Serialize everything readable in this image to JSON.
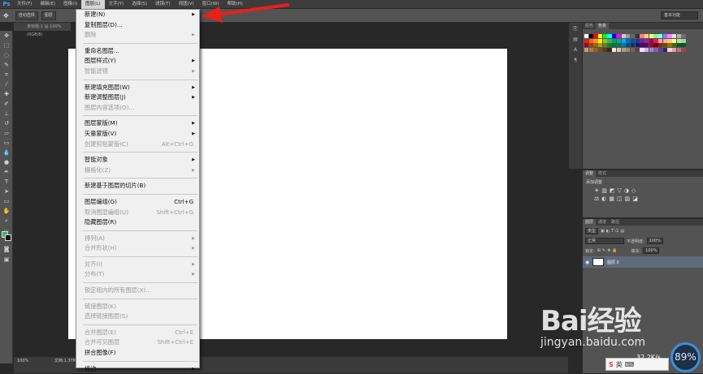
{
  "menubar": {
    "logo": "Ps",
    "items": [
      "文件(F)",
      "编辑(E)",
      "图像(I)",
      "图层(L)",
      "文字(Y)",
      "选择(S)",
      "滤镜(T)",
      "视图(V)",
      "窗口(W)",
      "帮助(H)"
    ],
    "active_index": 3
  },
  "options_bar": {
    "auto_select_label": "自动选择",
    "auto_select_value": "图层",
    "workspace": "基本功能"
  },
  "document": {
    "tab_title": "未标题-1 @ 100%(RGB/8)",
    "zoom": "100%",
    "doc_info": "文档:1.37M/0 字节"
  },
  "layer_menu": {
    "groups": [
      [
        {
          "label": "新建(N)",
          "submenu": true,
          "disabled": false
        },
        {
          "label": "复制图层(D)...",
          "disabled": false
        },
        {
          "label": "删除",
          "submenu": true,
          "disabled": true
        }
      ],
      [
        {
          "label": "重命名图层...",
          "disabled": false
        },
        {
          "label": "图层样式(Y)",
          "submenu": true,
          "disabled": false
        },
        {
          "label": "智能滤镜",
          "submenu": true,
          "disabled": true
        }
      ],
      [
        {
          "label": "新建填充图层(W)",
          "submenu": true,
          "disabled": false
        },
        {
          "label": "新建调整图层(J)",
          "submenu": true,
          "disabled": false
        },
        {
          "label": "图层内容选项(O)...",
          "disabled": true
        }
      ],
      [
        {
          "label": "图层蒙版(M)",
          "submenu": true,
          "disabled": false
        },
        {
          "label": "矢量蒙版(V)",
          "submenu": true,
          "disabled": false
        },
        {
          "label": "创建剪贴蒙版(C)",
          "shortcut": "Alt+Ctrl+G",
          "disabled": true
        }
      ],
      [
        {
          "label": "智能对象",
          "submenu": true,
          "disabled": false
        },
        {
          "label": "栅格化(Z)",
          "submenu": true,
          "disabled": true
        }
      ],
      [
        {
          "label": "新建基于图层的切片(B)",
          "disabled": false
        }
      ],
      [
        {
          "label": "图层编组(G)",
          "shortcut": "Ctrl+G",
          "disabled": false
        },
        {
          "label": "取消图层编组(U)",
          "shortcut": "Shift+Ctrl+G",
          "disabled": true
        },
        {
          "label": "隐藏图层(R)",
          "disabled": false
        }
      ],
      [
        {
          "label": "排列(A)",
          "submenu": true,
          "disabled": true
        },
        {
          "label": "合并形状(H)",
          "submenu": true,
          "disabled": true
        }
      ],
      [
        {
          "label": "对齐(I)",
          "submenu": true,
          "disabled": true
        },
        {
          "label": "分布(T)",
          "submenu": true,
          "disabled": true
        }
      ],
      [
        {
          "label": "锁定组内的所有图层(X)...",
          "disabled": true
        }
      ],
      [
        {
          "label": "链接图层(K)",
          "disabled": true
        },
        {
          "label": "选择链接图层(S)",
          "disabled": true
        }
      ],
      [
        {
          "label": "合并图层(E)",
          "shortcut": "Ctrl+E",
          "disabled": true
        },
        {
          "label": "合并可见图层",
          "shortcut": "Shift+Ctrl+E",
          "disabled": true
        },
        {
          "label": "拼合图像(F)",
          "disabled": false
        }
      ],
      [
        {
          "label": "修边",
          "submenu": true,
          "disabled": false
        }
      ]
    ]
  },
  "panels": {
    "swatch_tabs": [
      "颜色",
      "色板"
    ],
    "adjust_tabs": [
      "调整",
      "样式"
    ],
    "adjust_title": "添加调整",
    "layers_tabs": [
      "图层",
      "通道",
      "路径"
    ],
    "layers_kind": "类型",
    "blend_mode": "正常",
    "opacity_label": "不透明度:",
    "opacity_value": "100%",
    "lock_label": "锁定:",
    "fill_label": "填充:",
    "fill_value": "100%",
    "layer_name": "图层 0"
  },
  "colors": {
    "swatches": [
      "#ffffff",
      "#000000",
      "#ff0000",
      "#ffff00",
      "#00ff00",
      "#00ffff",
      "#0000ff",
      "#ff00ff",
      "#cccccc",
      "#999999",
      "#666666",
      "#333333",
      "#ff8080",
      "#ffcc80",
      "#ffff80",
      "#80ff80",
      "#80ffff",
      "#8080ff",
      "#ff80ff",
      "#e0e0e0",
      "#b0b0b0",
      "#707070",
      "#ed1c24",
      "#f26522",
      "#f7941d",
      "#fff200",
      "#8dc63f",
      "#39b54a",
      "#00a651",
      "#00a99d",
      "#00aeef",
      "#0072bc",
      "#0054a6",
      "#2e3192",
      "#662d91",
      "#92278f",
      "#9e005d",
      "#ed145b",
      "#f49ac1",
      "#f9ad81",
      "#fdc689",
      "#fff799",
      "#c4df9b",
      "#a3d39c",
      "#9e0b0f",
      "#a0410d",
      "#a36209",
      "#aba000",
      "#598527",
      "#1a7b30",
      "#007236",
      "#00746b",
      "#0076a3",
      "#004b80",
      "#003471",
      "#1b1464",
      "#440e62",
      "#630460",
      "#9e0039",
      "#790000",
      "#7b2e00",
      "#7d4900",
      "#827b00",
      "#406618",
      "#005e20",
      "#005826",
      "#c69c6d",
      "#a67c52",
      "#8c6239",
      "#754c24",
      "#603913",
      "#3c2415",
      "#f2e6d9",
      "#d9c5b2",
      "#b59a82",
      "#998675",
      "#736357",
      "#534741",
      "#f0e0ff",
      "#d0b0f0",
      "#a080d0",
      "#8060b0",
      "#604090",
      "#402070",
      "#f8d0d8",
      "#e0a0b0",
      "#c07080",
      "#a04060"
    ],
    "fg": "#2bb673",
    "bg": "#111111"
  },
  "watermark": {
    "logo": "Bai经验",
    "url": "jingyan.baidu.com"
  },
  "tray": {
    "ime": "英",
    "net_speed": "32.2K/s",
    "badge": "89%"
  }
}
